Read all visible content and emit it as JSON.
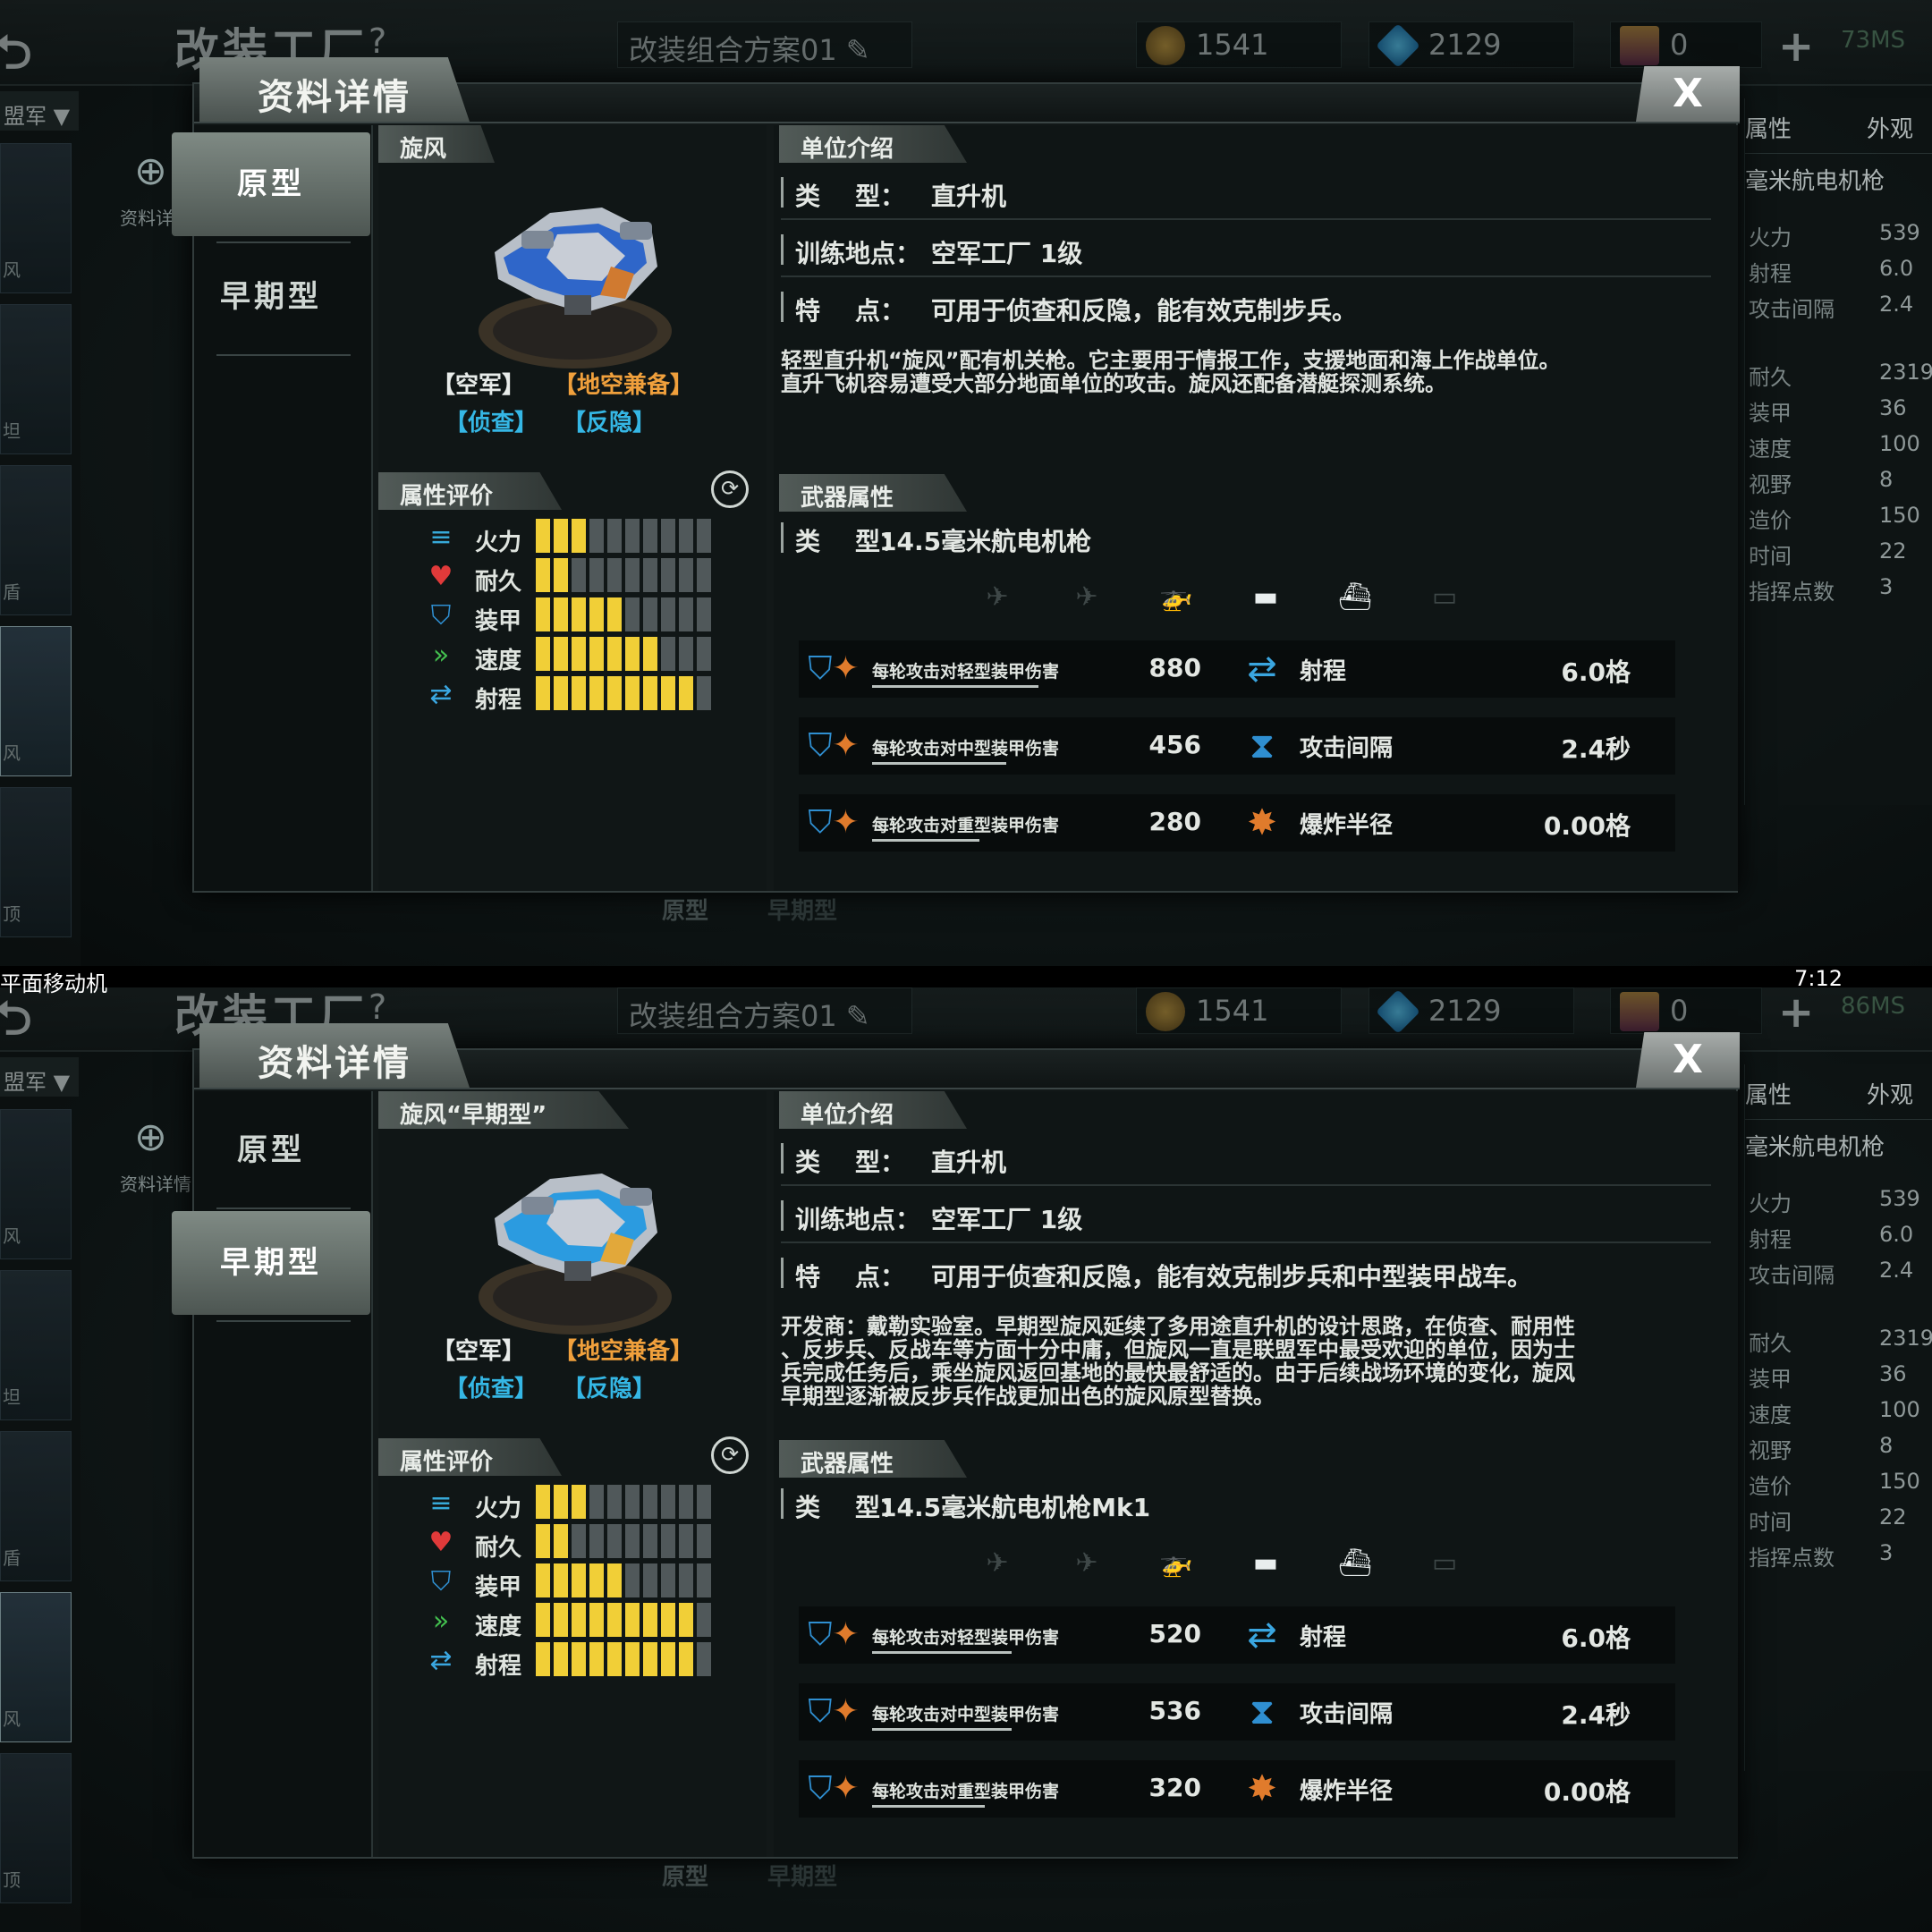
{
  "colors": {
    "bar_filled": "#f1cf37",
    "bar_empty": "#50585a",
    "tag_air": "#e8ecea",
    "tag_aa": "#f0a03c",
    "tag_recon": "#35b7e5"
  },
  "divider": {
    "left_text": "平面移动机",
    "right_text": "7:12"
  },
  "screens": [
    {
      "topbar": {
        "back_icon": "back-arrow-icon",
        "title": "改装工厂",
        "help": "?",
        "plan": "改装组合方案01",
        "coins": "1541",
        "gems": "2129",
        "cards": "0",
        "plus": "+",
        "memory": "73MS"
      },
      "left": {
        "filter": "盟军 ▼",
        "zoom_label": "资料详",
        "items": [
          "风",
          "坦",
          "盾",
          "风",
          "顶"
        ]
      },
      "right": {
        "tab1": "属性",
        "tab2": "外观",
        "title": "毫米航电机枪",
        "rows": [
          [
            "火力",
            "539"
          ],
          [
            "射程",
            "6.0"
          ],
          [
            "攻击间隔",
            "2.4"
          ],
          [
            "耐久",
            "2319"
          ],
          [
            "装甲",
            "36"
          ],
          [
            "速度",
            "100"
          ],
          [
            "视野",
            "8"
          ],
          [
            "造价",
            "150"
          ],
          [
            "时间",
            "22"
          ],
          [
            "指挥点数",
            "3"
          ]
        ]
      },
      "dialog": {
        "title": "资料详情",
        "close": "X",
        "tabs": [
          "原型",
          "早期型"
        ],
        "active_tab": 0,
        "unit_name": "旋风",
        "tags": {
          "air": "【空军】",
          "aa": "【地空兼备】",
          "recon": "【侦查】",
          "stealth": "【反隐】"
        },
        "eval_title": "属性评价",
        "stats": [
          {
            "label": "火力",
            "icon": "bullets-icon",
            "value": 3,
            "max": 10
          },
          {
            "label": "耐久",
            "icon": "heart-icon",
            "value": 2,
            "max": 10
          },
          {
            "label": "装甲",
            "icon": "shield-icon",
            "value": 5,
            "max": 10
          },
          {
            "label": "速度",
            "icon": "chevrons-icon",
            "value": 7,
            "max": 10
          },
          {
            "label": "射程",
            "icon": "range-arrow-icon",
            "value": 9,
            "max": 10
          }
        ],
        "intro_title": "单位介绍",
        "type_key": "类    型：",
        "type_val": "直升机",
        "train_key": "训练地点：",
        "train_val": "空军工厂 1级",
        "feat_key": "特    点：",
        "feat_val": "可用于侦查和反隐，能有效克制步兵。",
        "desc": [
          "轻型直升机“旋风”配有机关枪。它主要用于情报工作，支援地面和海上作战单位。",
          "直升飞机容易遭受大部分地面单位的攻击。旋风还配备潜艇探测系统。"
        ],
        "weapon_title": "武器属性",
        "wtype_key": "类    型：",
        "wtype_val": "14.5毫米航电机枪",
        "damage": [
          {
            "label": "每轮攻击对轻型装甲伤害",
            "value": "880",
            "rlabel": "射程",
            "rvalue": "6.0格",
            "ul": 186
          },
          {
            "label": "每轮攻击对中型装甲伤害",
            "value": "456",
            "rlabel": "攻击间隔",
            "rvalue": "2.4秒",
            "ul": 150
          },
          {
            "label": "每轮攻击对重型装甲伤害",
            "value": "280",
            "rlabel": "爆炸半径",
            "rvalue": "0.00格",
            "ul": 120
          }
        ]
      },
      "below": {
        "a": "原型",
        "b": "早期型"
      }
    },
    {
      "topbar": {
        "back_icon": "back-arrow-icon",
        "title": "改装工厂",
        "help": "?",
        "plan": "改装组合方案01",
        "coins": "1541",
        "gems": "2129",
        "cards": "0",
        "plus": "+",
        "memory": "86MS"
      },
      "left": {
        "filter": "盟军 ▼",
        "zoom_label": "资料详情",
        "items": [
          "风",
          "坦",
          "盾",
          "风",
          "顶"
        ]
      },
      "right": {
        "tab1": "属性",
        "tab2": "外观",
        "title": "毫米航电机枪",
        "rows": [
          [
            "火力",
            "539"
          ],
          [
            "射程",
            "6.0"
          ],
          [
            "攻击间隔",
            "2.4"
          ],
          [
            "耐久",
            "2319"
          ],
          [
            "装甲",
            "36"
          ],
          [
            "速度",
            "100"
          ],
          [
            "视野",
            "8"
          ],
          [
            "造价",
            "150"
          ],
          [
            "时间",
            "22"
          ],
          [
            "指挥点数",
            "3"
          ]
        ]
      },
      "dialog": {
        "title": "资料详情",
        "close": "X",
        "tabs": [
          "原型",
          "早期型"
        ],
        "active_tab": 1,
        "unit_name": "旋风“早期型”",
        "tags": {
          "air": "【空军】",
          "aa": "【地空兼备】",
          "recon": "【侦查】",
          "stealth": "【反隐】"
        },
        "eval_title": "属性评价",
        "stats": [
          {
            "label": "火力",
            "icon": "bullets-icon",
            "value": 3,
            "max": 10
          },
          {
            "label": "耐久",
            "icon": "heart-icon",
            "value": 2,
            "max": 10
          },
          {
            "label": "装甲",
            "icon": "shield-icon",
            "value": 5,
            "max": 10
          },
          {
            "label": "速度",
            "icon": "chevrons-icon",
            "value": 9,
            "max": 10
          },
          {
            "label": "射程",
            "icon": "range-arrow-icon",
            "value": 9,
            "max": 10
          }
        ],
        "intro_title": "单位介绍",
        "type_key": "类    型：",
        "type_val": "直升机",
        "train_key": "训练地点：",
        "train_val": "空军工厂 1级",
        "feat_key": "特    点：",
        "feat_val": "可用于侦查和反隐，能有效克制步兵和中型装甲战车。",
        "desc": [
          "开发商：戴勒实验室。早期型旋风延续了多用途直升机的设计思路，在侦查、耐用性",
          "、反步兵、反战车等方面十分中庸，但旋风一直是联盟军中最受欢迎的单位，因为士",
          "兵完成任务后，乘坐旋风返回基地的最快最舒适的。由于后续战场环境的变化，旋风",
          "早期型逐渐被反步兵作战更加出色的旋风原型替换。"
        ],
        "weapon_title": "武器属性",
        "wtype_key": "类    型：",
        "wtype_val": "14.5毫米航电机枪Mk1",
        "damage": [
          {
            "label": "每轮攻击对轻型装甲伤害",
            "value": "520",
            "rlabel": "射程",
            "rvalue": "6.0格",
            "ul": 156
          },
          {
            "label": "每轮攻击对中型装甲伤害",
            "value": "536",
            "rlabel": "攻击间隔",
            "rvalue": "2.4秒",
            "ul": 156
          },
          {
            "label": "每轮攻击对重型装甲伤害",
            "value": "320",
            "rlabel": "爆炸半径",
            "rvalue": "0.00格",
            "ul": 126
          }
        ]
      },
      "below": {
        "a": "原型",
        "b": "早期型"
      }
    }
  ]
}
